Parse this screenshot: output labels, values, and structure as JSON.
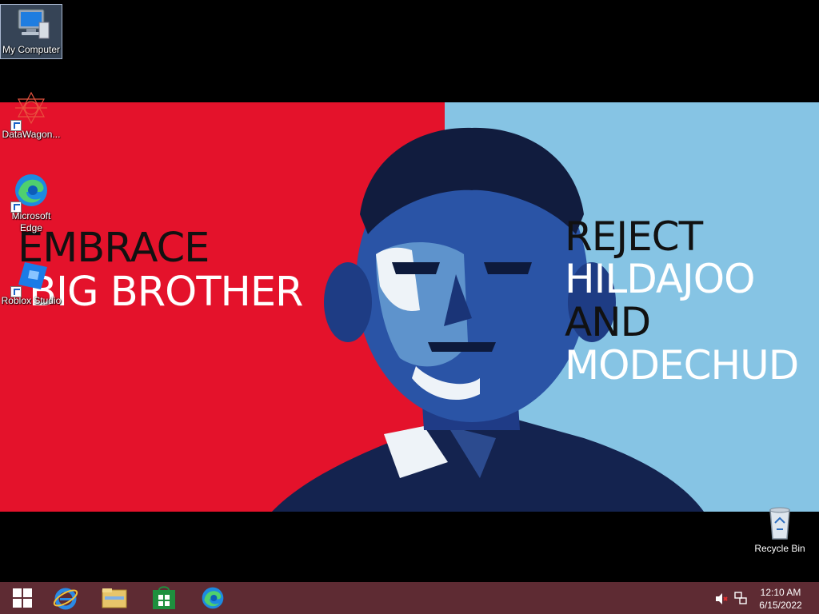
{
  "desktop": {
    "icons": [
      {
        "label": "My Computer"
      },
      {
        "label": "DataWagon..."
      },
      {
        "label": "Microsoft Edge"
      },
      {
        "label": "Roblox Studio"
      },
      {
        "label": "Recycle Bin"
      }
    ]
  },
  "wallpaper": {
    "left_line1": "EMBRACE",
    "left_line2": "BIG BROTHER",
    "right_line1": "REJECT",
    "right_line2": "HILDAJOO",
    "right_line3": "AND",
    "right_line4": "MODECHUD",
    "colors": {
      "red": "#e4122b",
      "blue": "#86c4e4",
      "navy": "#14234f"
    }
  },
  "taskbar": {
    "buttons": [
      "start-icon",
      "internet-explorer-icon",
      "file-explorer-icon",
      "store-icon",
      "edge-icon"
    ],
    "tray": {
      "volume_icon": "volume-muted-icon",
      "network_icon": "network-icon",
      "time": "12:10 AM",
      "date": "6/15/2022"
    },
    "color": "#5e2b33"
  }
}
